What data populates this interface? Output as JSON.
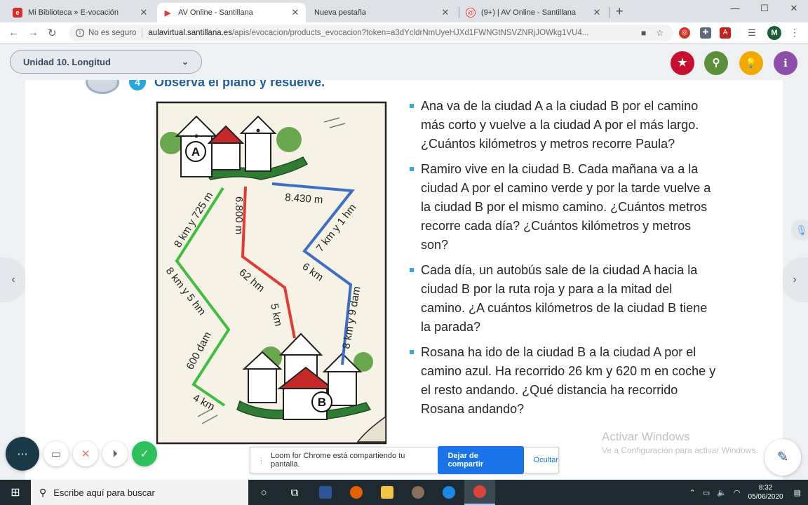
{
  "browser": {
    "tabs": [
      {
        "title": "Mi Biblioteca » E-vocación",
        "favicon": "e"
      },
      {
        "title": "AV Online - Santillana",
        "favicon": "▶"
      },
      {
        "title": "Nueva pestaña",
        "favicon": ""
      },
      {
        "title": "(9+) | AV Online - Santillana",
        "favicon": "@"
      }
    ],
    "new_tab_icon": "+",
    "controls": {
      "minimize": "—",
      "maximize": "☐",
      "close": "✕"
    },
    "nav": {
      "back": "←",
      "forward": "→",
      "reload": "↻"
    },
    "security_label": "No es seguro",
    "url_host": "aulavirtual.santillana.es",
    "url_path": "/apis/evocacion/products_evocacion?token=a3dYcldrNmUyeHJXd1FWNGtNSVZNRjJOWkg1VU4...",
    "profile_initial": "M"
  },
  "header": {
    "unit_label": "Unidad 10. Longitud",
    "unit_chevron": "⌄",
    "buttons": [
      {
        "name": "favorite-button",
        "icon": "★",
        "color": "#c8102e"
      },
      {
        "name": "search-button",
        "icon": "⚲",
        "color": "#5b8f3a"
      },
      {
        "name": "light-button",
        "icon": "💡",
        "color": "#f2a900"
      },
      {
        "name": "info-button",
        "icon": "i",
        "color": "#8d4fa8"
      }
    ]
  },
  "exercise": {
    "heading": "Observa el plano y resuelve.",
    "number": "4"
  },
  "map": {
    "city_a": "A",
    "city_b": "B",
    "green_labels": [
      "8 km y 725 m",
      "8 km y 5 hm",
      "600 dam",
      "4 km"
    ],
    "red_labels": [
      "6.800 m",
      "62 hm",
      "5 km"
    ],
    "blue_labels": [
      "8.430 m",
      "7 km y 1 hm",
      "6 km",
      "8 km y 9 dam"
    ]
  },
  "tasks": [
    "Ana va de la ciudad A a la ciudad B por el camino más corto y vuelve a la ciudad A por el más largo. ¿Cuántos kilómetros y metros recorre Paula?",
    "Ramiro vive en la ciudad B. Cada mañana va a la ciudad A por el camino verde y por la tarde vuelve a la ciudad B por el mismo camino. ¿Cuántos metros recorre cada día? ¿Cuántos kilómetros y metros son?",
    "Cada día, un autobús sale de la ciudad A hacia la ciudad B por la ruta roja y para a la mitad del camino. ¿A cuántos kilómetros de la ciudad B tiene la parada?",
    "Rosana ha ido de la ciudad B a la ciudad A por el camino azul. Ha recorrido 26 km y 620 m en coche y el resto andando. ¿Qué distancia ha recorrido Rosana andando?"
  ],
  "loom": {
    "message": "Loom for Chrome está compartiendo tu pantalla.",
    "stop_label": "Dejar de compartir",
    "hide_label": "Ocultar"
  },
  "watermark": {
    "line1": "Activar Windows",
    "line2": "Ve a Configuración para activar Windows."
  },
  "taskbar": {
    "search_placeholder": "Escribe aquí para buscar",
    "time": "8:32",
    "date": "05/06/2020"
  }
}
